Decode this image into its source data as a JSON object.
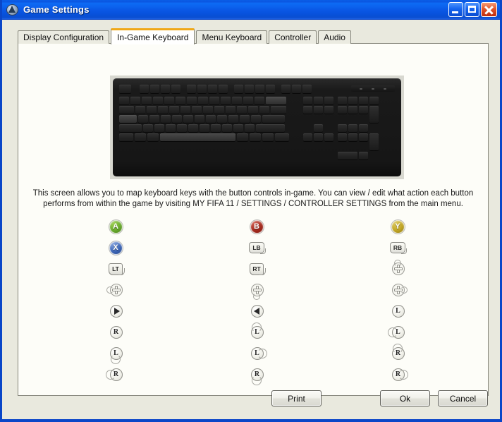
{
  "window": {
    "title": "Game Settings",
    "icon": "app-triangle-icon",
    "controls": {
      "minimize": "Minimize",
      "maximize": "Maximize",
      "close": "Close"
    }
  },
  "tabs": [
    {
      "label": "Display Configuration",
      "active": false
    },
    {
      "label": "In-Game Keyboard",
      "active": true
    },
    {
      "label": "Menu Keyboard",
      "active": false
    },
    {
      "label": "Controller",
      "active": false
    },
    {
      "label": "Audio",
      "active": false
    }
  ],
  "keyboard_image": {
    "alt": "Black full-size PC keyboard",
    "color": "#1a1a1a"
  },
  "instructions": {
    "line1": "This screen allows you to map keyboard keys with the button controls in-game. You can view / edit what action each button",
    "line2": "performs from within the game by visiting MY FIFA 11 / SETTINGS / CONTROLLER SETTINGS from the main menu."
  },
  "colors": {
    "titlebar_blue": "#0a58e6",
    "close_red": "#d23b17",
    "active_tab_accent": "#f0a818",
    "dialog_bg": "#e9e9de",
    "panel_bg": "#fdfdf8",
    "button_a_green": "#66a82a",
    "button_b_red": "#a3291c",
    "button_x_blue": "#3a63b4",
    "button_y_yellow": "#bfa423"
  },
  "mapping": {
    "columns": [
      {
        "name": "column-1",
        "items": [
          {
            "icon": "button-a-icon",
            "label": "A",
            "type": "face",
            "variant": "a"
          },
          {
            "icon": "button-x-icon",
            "label": "X",
            "type": "face",
            "variant": "x"
          },
          {
            "icon": "trigger-lt-icon",
            "label": "LT",
            "type": "trigger"
          },
          {
            "icon": "dpad-left-icon",
            "label": "",
            "type": "dpad",
            "dir": "left"
          },
          {
            "icon": "stick-right-icon",
            "label": "",
            "type": "stick-arrow",
            "dir": "right"
          },
          {
            "icon": "right-stick-icon",
            "label": "R",
            "type": "stick"
          },
          {
            "icon": "left-stick-down-icon",
            "label": "L",
            "type": "stick",
            "dir": "down"
          },
          {
            "icon": "right-stick-left-icon",
            "label": "R",
            "type": "stick",
            "dir": "left"
          }
        ]
      },
      {
        "name": "column-2",
        "items": [
          {
            "icon": "button-b-icon",
            "label": "B",
            "type": "face",
            "variant": "b"
          },
          {
            "icon": "shoulder-lb-icon",
            "label": "LB",
            "type": "shoulder"
          },
          {
            "icon": "trigger-rt-icon",
            "label": "RT",
            "type": "trigger"
          },
          {
            "icon": "dpad-down-icon",
            "label": "",
            "type": "dpad",
            "dir": "down"
          },
          {
            "icon": "stick-left-icon",
            "label": "",
            "type": "stick-arrow",
            "dir": "left"
          },
          {
            "icon": "left-stick-up-icon",
            "label": "L",
            "type": "stick",
            "dir": "up"
          },
          {
            "icon": "left-stick-right-icon",
            "label": "L",
            "type": "stick",
            "dir": "right"
          },
          {
            "icon": "right-stick-down-icon",
            "label": "R",
            "type": "stick",
            "dir": "down"
          }
        ]
      },
      {
        "name": "column-3",
        "items": [
          {
            "icon": "button-y-icon",
            "label": "Y",
            "type": "face",
            "variant": "y"
          },
          {
            "icon": "shoulder-rb-icon",
            "label": "RB",
            "type": "shoulder"
          },
          {
            "icon": "dpad-up-icon",
            "label": "",
            "type": "dpad",
            "dir": "up"
          },
          {
            "icon": "dpad-right-icon",
            "label": "",
            "type": "dpad",
            "dir": "right"
          },
          {
            "icon": "left-stick-icon",
            "label": "L",
            "type": "stick"
          },
          {
            "icon": "left-stick-left-icon",
            "label": "L",
            "type": "stick",
            "dir": "left"
          },
          {
            "icon": "right-stick-up-icon",
            "label": "R",
            "type": "stick",
            "dir": "up"
          },
          {
            "icon": "right-stick-right-icon",
            "label": "R",
            "type": "stick",
            "dir": "right"
          }
        ]
      }
    ]
  },
  "footer": {
    "print": "Print",
    "ok": "Ok",
    "cancel": "Cancel"
  }
}
